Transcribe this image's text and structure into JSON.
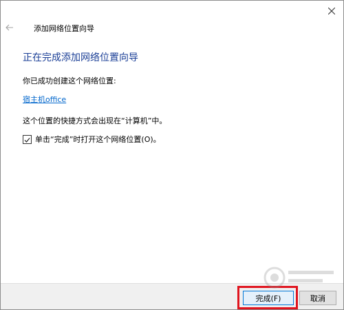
{
  "window": {
    "title": "添加网络位置向导",
    "close_icon": "close-icon",
    "back_icon": "back-arrow-icon"
  },
  "content": {
    "heading": "正在完成添加网络位置向导",
    "success_text": "你已成功创建这个网络位置:",
    "location_name": "宿主机office",
    "shortcut_text": "这个位置的快捷方式会出现在“计算机”中。",
    "checkbox_label": "单击“完成”时打开这个网络位置(O)。",
    "checkbox_checked": true
  },
  "footer": {
    "finish_label": "完成(F)",
    "cancel_label": "取消"
  },
  "colors": {
    "heading": "#1a3e96",
    "link": "#0066cc",
    "highlight": "#e0141e"
  }
}
